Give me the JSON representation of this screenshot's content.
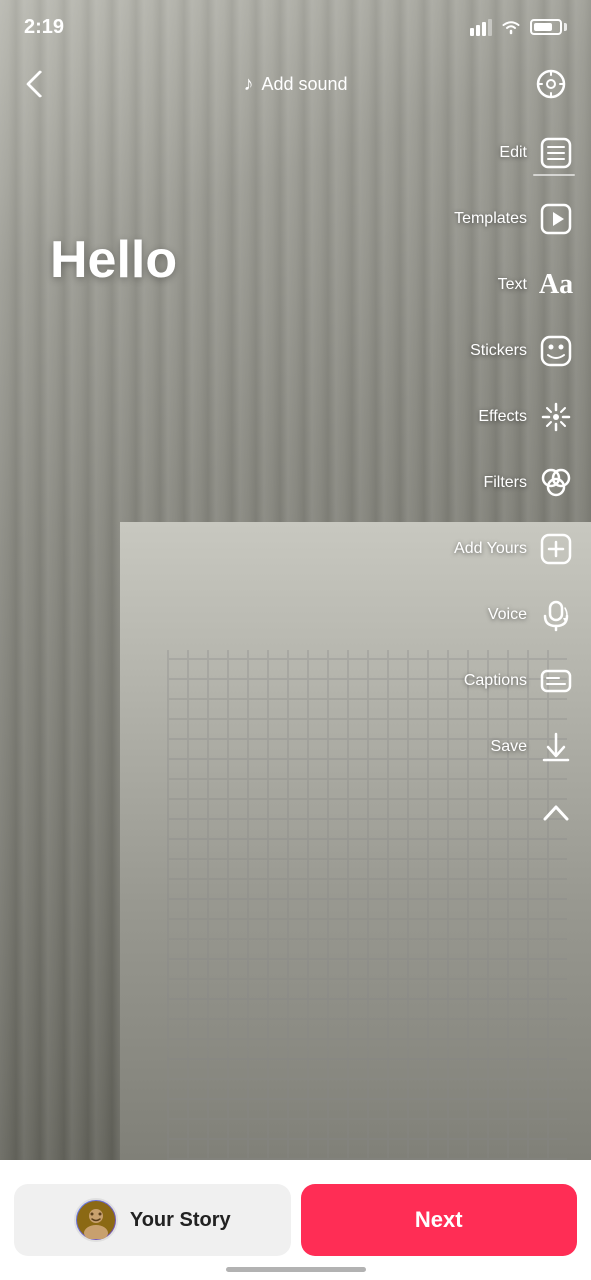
{
  "statusBar": {
    "time": "2:19",
    "battery": "74"
  },
  "header": {
    "addSound": "Add sound",
    "backLabel": "Back",
    "settingsLabel": "Settings"
  },
  "overlay": {
    "helloText": "Hello"
  },
  "tools": [
    {
      "id": "edit",
      "label": "Edit",
      "icon": "edit-icon"
    },
    {
      "id": "templates",
      "label": "Templates",
      "icon": "templates-icon"
    },
    {
      "id": "text",
      "label": "Text",
      "icon": "text-icon"
    },
    {
      "id": "stickers",
      "label": "Stickers",
      "icon": "stickers-icon"
    },
    {
      "id": "effects",
      "label": "Effects",
      "icon": "effects-icon"
    },
    {
      "id": "filters",
      "label": "Filters",
      "icon": "filters-icon"
    },
    {
      "id": "addyours",
      "label": "Add Yours",
      "icon": "addyours-icon"
    },
    {
      "id": "voice",
      "label": "Voice",
      "icon": "voice-icon"
    },
    {
      "id": "captions",
      "label": "Captions",
      "icon": "captions-icon"
    },
    {
      "id": "save",
      "label": "Save",
      "icon": "save-icon"
    }
  ],
  "bottomBar": {
    "yourStory": "Your Story",
    "next": "Next"
  }
}
